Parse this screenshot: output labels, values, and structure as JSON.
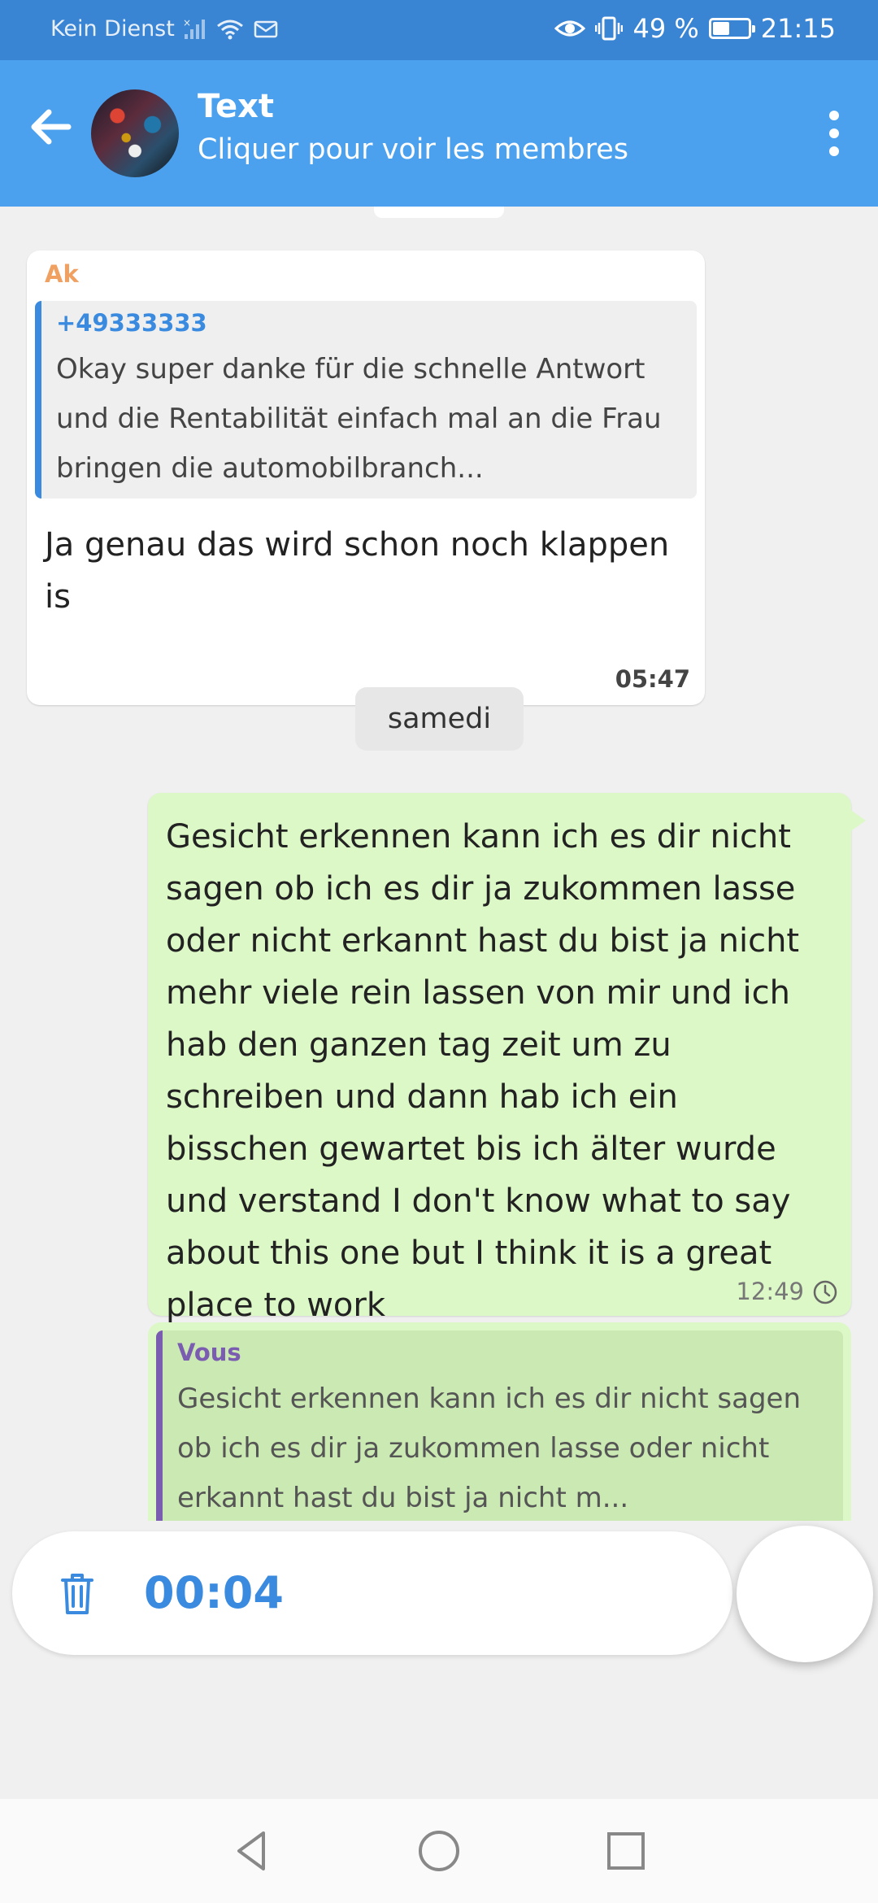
{
  "status_bar": {
    "carrier": "Kein Dienst",
    "battery_percent": "49 %",
    "battery_level": 0.49,
    "time": "21:15"
  },
  "header": {
    "title": "Text",
    "subtitle": "Cliquer pour voir les membres"
  },
  "messages": {
    "incoming": {
      "sender": "Ak",
      "quote": {
        "author": "+49333333",
        "text": "Okay super danke für die schnelle Antwort und die Rentabilität einfach mal an die Frau bringen die automobilbranch...",
        "accent_color": "#3a8be0"
      },
      "text": "Ja genau das wird schon noch klappen is",
      "time": "05:47"
    },
    "date_separator": "samedi",
    "outgoing": {
      "text": "Gesicht erkennen kann ich es dir nicht sagen ob ich es dir ja zukommen lasse oder nicht erkannt hast du bist ja nicht mehr viele rein lassen von mir und ich hab den ganzen tag zeit um zu schreiben und dann hab ich ein bisschen gewartet bis ich älter wurde und verstand I don't know what to say about this one but I think it is a great place to work",
      "time": "12:49",
      "status_icon": "clock-icon"
    },
    "outgoing_reply": {
      "quote": {
        "author": "Vous",
        "text": "Gesicht erkennen kann ich es dir nicht sagen ob ich es dir ja zukommen lasse oder nicht erkannt hast du bist ja nicht m...",
        "accent_color": "#7a5cb0"
      }
    }
  },
  "recorder": {
    "timer": "00:04",
    "trash_icon": "trash-icon"
  },
  "colors": {
    "status_bar": "#3a84d4",
    "app_bar": "#4ca1ee",
    "outgoing_bubble": "#dcf8c6",
    "sender_name": "#f0a060"
  }
}
